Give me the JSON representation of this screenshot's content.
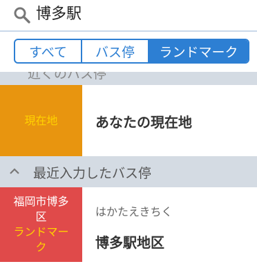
{
  "search": {
    "value": "博多駅"
  },
  "tabs": [
    {
      "label": "すべて",
      "active": false
    },
    {
      "label": "バス停",
      "active": false
    },
    {
      "label": "ランドマーク",
      "active": true
    }
  ],
  "partial_header": "近くのバス停",
  "current_location": {
    "thumb_label": "現在地",
    "name": "あなたの現在地"
  },
  "recent_section": {
    "title": "最近入力したバス停"
  },
  "recent_items": [
    {
      "thumb_line1": "福岡市博多",
      "thumb_line2": "区",
      "thumb_type_line1": "ランドマー",
      "thumb_type_line2": "ク",
      "reading": "はかたえきちく",
      "name": "博多駅地区"
    }
  ],
  "colors": {
    "accent": "#2d7fd3",
    "current_location_bg": "#e8950f",
    "current_location_text": "#ffd200",
    "landmark_bg": "#e04a4a",
    "landmark_type_text": "#ffd200",
    "section_bg": "#d4dbe3"
  }
}
